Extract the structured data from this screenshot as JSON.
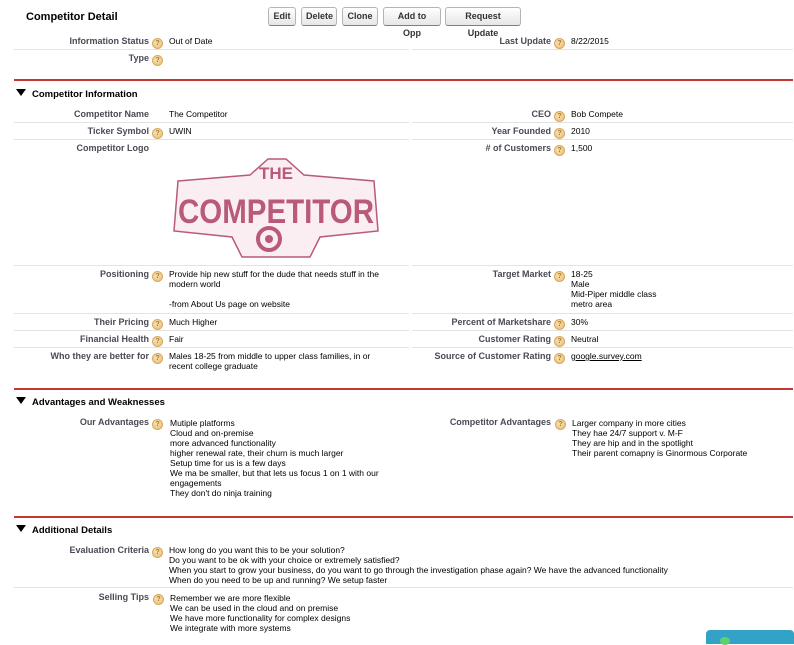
{
  "header": {
    "title": "Competitor Detail",
    "buttons": {
      "edit": "Edit",
      "delete": "Delete",
      "clone": "Clone",
      "add_to_opp": "Add to Opp",
      "request_update": "Request Update"
    }
  },
  "summary": {
    "information_status_label": "Information Status",
    "information_status_value": "Out of Date",
    "last_update_label": "Last Update",
    "last_update_value": "8/22/2015",
    "type_label": "Type"
  },
  "competitor_info": {
    "section_title": "Competitor Information",
    "competitor_name_label": "Competitor Name",
    "competitor_name_value": "The Competitor",
    "ceo_label": "CEO",
    "ceo_value": "Bob Compete",
    "ticker_label": "Ticker Symbol",
    "ticker_value": "UWIN",
    "year_founded_label": "Year Founded",
    "year_founded_value": "2010",
    "logo_label": "Competitor Logo",
    "logo_line1": "THE",
    "logo_line2": "COMPETITOR",
    "customers_label": "# of Customers",
    "customers_value": "1,500",
    "positioning_label": "Positioning",
    "positioning_value": "Provide hip new stuff for the dude that needs stuff in the\nmodern world\n\n-from About Us page on website",
    "target_market_label": "Target Market",
    "target_market_value": "18-25\nMale\nMid-Piper middle class\nmetro area",
    "pricing_label": "Their Pricing",
    "pricing_value": "Much Higher",
    "marketshare_label": "Percent of Marketshare",
    "marketshare_value": "30%",
    "financial_label": "Financial Health",
    "financial_value": "Fair",
    "customer_rating_label": "Customer Rating",
    "customer_rating_value": "Neutral",
    "better_for_label": "Who they are better for",
    "better_for_value": "Males 18-25 from middle to upper class families, in or\nrecent college graduate",
    "source_rating_label": "Source of Customer Rating",
    "source_rating_value": "google.survey.com"
  },
  "advantages": {
    "section_title": "Advantages and Weaknesses",
    "our_label": "Our Advantages",
    "our_value": "Mutiple platforms\nCloud and on-premise\nmore advanced functionality\nhigher renewal rate, their churn is much larger\nSetup time for us is a few days\nWe ma be smaller, but that lets us focus 1 on 1 with our\nengagements\nThey don't do ninja training",
    "competitor_label": "Competitor Advantages",
    "competitor_value": "Larger company in more cities\nThey hae 24/7 support v. M-F\nThey are hip and in the spotlight\nTheir parent comapny is Ginormous Corporate"
  },
  "additional": {
    "section_title": "Additional Details",
    "eval_label": "Evaluation Criteria",
    "eval_value": "How long do you want this to be your solution?\nDo you want to be ok with your choice or extremely satisfied?\nWhen you start to grow your business, do you want to go through the investigation phase again? We have the advanced functionality\nWhen do you need to be up and running? We setup faster",
    "selling_label": "Selling Tips",
    "selling_value": "Remember we are more flexible\nWe can be used in the cloud and on premise\nWe have more functionality for complex designs\nWe integrate with more systems"
  },
  "colors": {
    "accent_line": "#c23934",
    "label_text": "#4a4a56",
    "logo": "#b85a78",
    "chat": "#32a3c7"
  },
  "icons": {
    "help": "help-icon",
    "collapse": "triangle-down-icon"
  }
}
